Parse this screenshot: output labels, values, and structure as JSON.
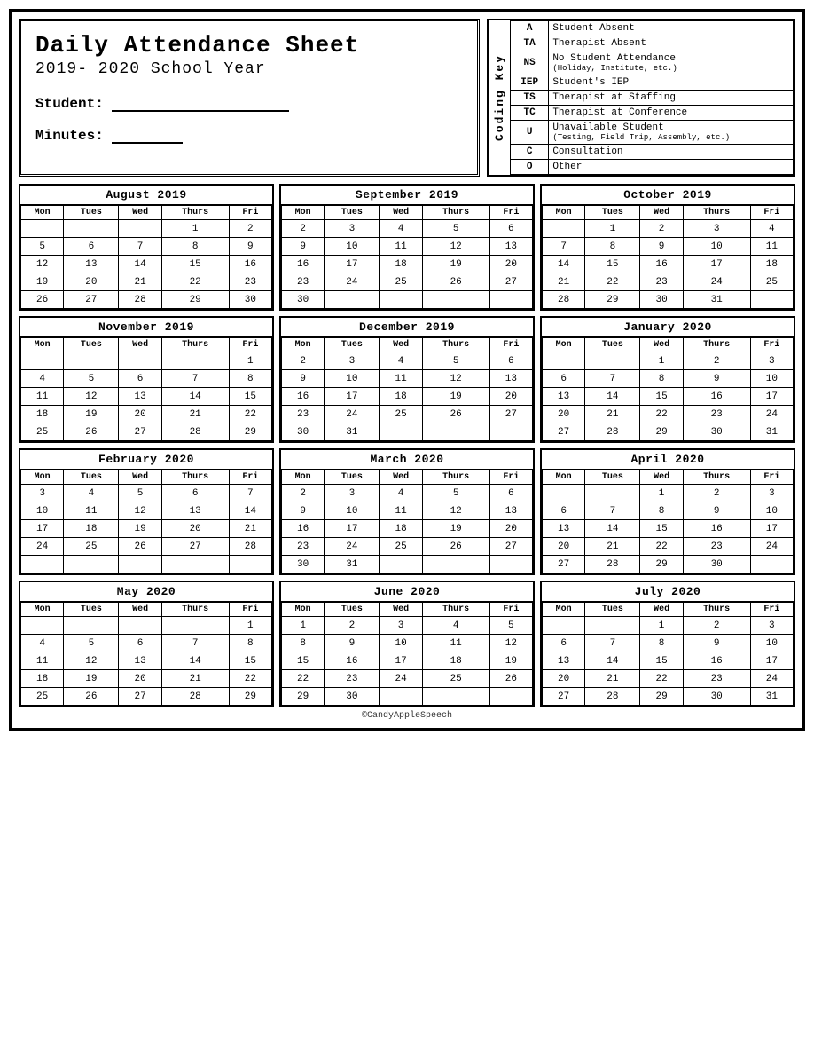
{
  "title": {
    "main": "Daily Attendance Sheet",
    "subtitle": "2019- 2020 School Year",
    "student_label": "Student:",
    "minutes_label": "Minutes:"
  },
  "coding_key": {
    "label": "Coding Key",
    "items": [
      {
        "code": "A",
        "description": "Student Absent",
        "note": ""
      },
      {
        "code": "TA",
        "description": "Therapist Absent",
        "note": ""
      },
      {
        "code": "NS",
        "description": "No Student Attendance",
        "note": "(Holiday, Institute, etc.)"
      },
      {
        "code": "IEP",
        "description": "Student's IEP",
        "note": ""
      },
      {
        "code": "TS",
        "description": "Therapist at Staffing",
        "note": ""
      },
      {
        "code": "TC",
        "description": "Therapist at Conference",
        "note": ""
      },
      {
        "code": "U",
        "description": "Unavailable Student",
        "note": "(Testing, Field Trip, Assembly, etc.)"
      },
      {
        "code": "C",
        "description": "Consultation",
        "note": ""
      },
      {
        "code": "O",
        "description": "Other",
        "note": ""
      }
    ]
  },
  "calendars": [
    {
      "title": "August 2019",
      "days": [
        "Mon",
        "Tues",
        "Wed",
        "Thurs",
        "Fri"
      ],
      "weeks": [
        [
          "",
          "",
          "",
          "1",
          "2"
        ],
        [
          "5",
          "6",
          "7",
          "8",
          "9"
        ],
        [
          "12",
          "13",
          "14",
          "15",
          "16"
        ],
        [
          "19",
          "20",
          "21",
          "22",
          "23"
        ],
        [
          "26",
          "27",
          "28",
          "29",
          "30"
        ]
      ]
    },
    {
      "title": "September 2019",
      "days": [
        "Mon",
        "Tues",
        "Wed",
        "Thurs",
        "Fri"
      ],
      "weeks": [
        [
          "2",
          "3",
          "4",
          "5",
          "6"
        ],
        [
          "9",
          "10",
          "11",
          "12",
          "13"
        ],
        [
          "16",
          "17",
          "18",
          "19",
          "20"
        ],
        [
          "23",
          "24",
          "25",
          "26",
          "27"
        ],
        [
          "30",
          "",
          "",
          "",
          ""
        ]
      ]
    },
    {
      "title": "October 2019",
      "days": [
        "Mon",
        "Tues",
        "Wed",
        "Thurs",
        "Fri"
      ],
      "weeks": [
        [
          "",
          "1",
          "2",
          "3",
          "4"
        ],
        [
          "7",
          "8",
          "9",
          "10",
          "11"
        ],
        [
          "14",
          "15",
          "16",
          "17",
          "18"
        ],
        [
          "21",
          "22",
          "23",
          "24",
          "25"
        ],
        [
          "28",
          "29",
          "30",
          "31",
          ""
        ]
      ]
    },
    {
      "title": "November 2019",
      "days": [
        "Mon",
        "Tues",
        "Wed",
        "Thurs",
        "Fri"
      ],
      "weeks": [
        [
          "",
          "",
          "",
          "",
          "1"
        ],
        [
          "4",
          "5",
          "6",
          "7",
          "8"
        ],
        [
          "11",
          "12",
          "13",
          "14",
          "15"
        ],
        [
          "18",
          "19",
          "20",
          "21",
          "22"
        ],
        [
          "25",
          "26",
          "27",
          "28",
          "29"
        ]
      ]
    },
    {
      "title": "December 2019",
      "days": [
        "Mon",
        "Tues",
        "Wed",
        "Thurs",
        "Fri"
      ],
      "weeks": [
        [
          "2",
          "3",
          "4",
          "5",
          "6"
        ],
        [
          "9",
          "10",
          "11",
          "12",
          "13"
        ],
        [
          "16",
          "17",
          "18",
          "19",
          "20"
        ],
        [
          "23",
          "24",
          "25",
          "26",
          "27"
        ],
        [
          "30",
          "31",
          "",
          "",
          ""
        ]
      ]
    },
    {
      "title": "January 2020",
      "days": [
        "Mon",
        "Tues",
        "Wed",
        "Thurs",
        "Fri"
      ],
      "weeks": [
        [
          "",
          "",
          "1",
          "2",
          "3"
        ],
        [
          "6",
          "7",
          "8",
          "9",
          "10"
        ],
        [
          "13",
          "14",
          "15",
          "16",
          "17"
        ],
        [
          "20",
          "21",
          "22",
          "23",
          "24"
        ],
        [
          "27",
          "28",
          "29",
          "30",
          "31"
        ]
      ]
    },
    {
      "title": "February 2020",
      "days": [
        "Mon",
        "Tues",
        "Wed",
        "Thurs",
        "Fri"
      ],
      "weeks": [
        [
          "3",
          "4",
          "5",
          "6",
          "7"
        ],
        [
          "10",
          "11",
          "12",
          "13",
          "14"
        ],
        [
          "17",
          "18",
          "19",
          "20",
          "21"
        ],
        [
          "24",
          "25",
          "26",
          "27",
          "28"
        ],
        [
          "",
          "",
          "",
          "",
          ""
        ]
      ]
    },
    {
      "title": "March 2020",
      "days": [
        "Mon",
        "Tues",
        "Wed",
        "Thurs",
        "Fri"
      ],
      "weeks": [
        [
          "2",
          "3",
          "4",
          "5",
          "6"
        ],
        [
          "9",
          "10",
          "11",
          "12",
          "13"
        ],
        [
          "16",
          "17",
          "18",
          "19",
          "20"
        ],
        [
          "23",
          "24",
          "25",
          "26",
          "27"
        ],
        [
          "30",
          "31",
          "",
          "",
          ""
        ]
      ]
    },
    {
      "title": "April 2020",
      "days": [
        "Mon",
        "Tues",
        "Wed",
        "Thurs",
        "Fri"
      ],
      "weeks": [
        [
          "",
          "",
          "1",
          "2",
          "3"
        ],
        [
          "6",
          "7",
          "8",
          "9",
          "10"
        ],
        [
          "13",
          "14",
          "15",
          "16",
          "17"
        ],
        [
          "20",
          "21",
          "22",
          "23",
          "24"
        ],
        [
          "27",
          "28",
          "29",
          "30",
          ""
        ]
      ]
    },
    {
      "title": "May 2020",
      "days": [
        "Mon",
        "Tues",
        "Wed",
        "Thurs",
        "Fri"
      ],
      "weeks": [
        [
          "",
          "",
          "",
          "",
          "1"
        ],
        [
          "4",
          "5",
          "6",
          "7",
          "8"
        ],
        [
          "11",
          "12",
          "13",
          "14",
          "15"
        ],
        [
          "18",
          "19",
          "20",
          "21",
          "22"
        ],
        [
          "25",
          "26",
          "27",
          "28",
          "29"
        ]
      ]
    },
    {
      "title": "June 2020",
      "days": [
        "Mon",
        "Tues",
        "Wed",
        "Thurs",
        "Fri"
      ],
      "weeks": [
        [
          "1",
          "2",
          "3",
          "4",
          "5"
        ],
        [
          "8",
          "9",
          "10",
          "11",
          "12"
        ],
        [
          "15",
          "16",
          "17",
          "18",
          "19"
        ],
        [
          "22",
          "23",
          "24",
          "25",
          "26"
        ],
        [
          "29",
          "30",
          "",
          "",
          ""
        ]
      ]
    },
    {
      "title": "July 2020",
      "days": [
        "Mon",
        "Tues",
        "Wed",
        "Thurs",
        "Fri"
      ],
      "weeks": [
        [
          "",
          "",
          "1",
          "2",
          "3"
        ],
        [
          "6",
          "7",
          "8",
          "9",
          "10"
        ],
        [
          "13",
          "14",
          "15",
          "16",
          "17"
        ],
        [
          "20",
          "21",
          "22",
          "23",
          "24"
        ],
        [
          "27",
          "28",
          "29",
          "30",
          "31"
        ]
      ]
    }
  ],
  "footer": "©CandyAppleSpeech"
}
